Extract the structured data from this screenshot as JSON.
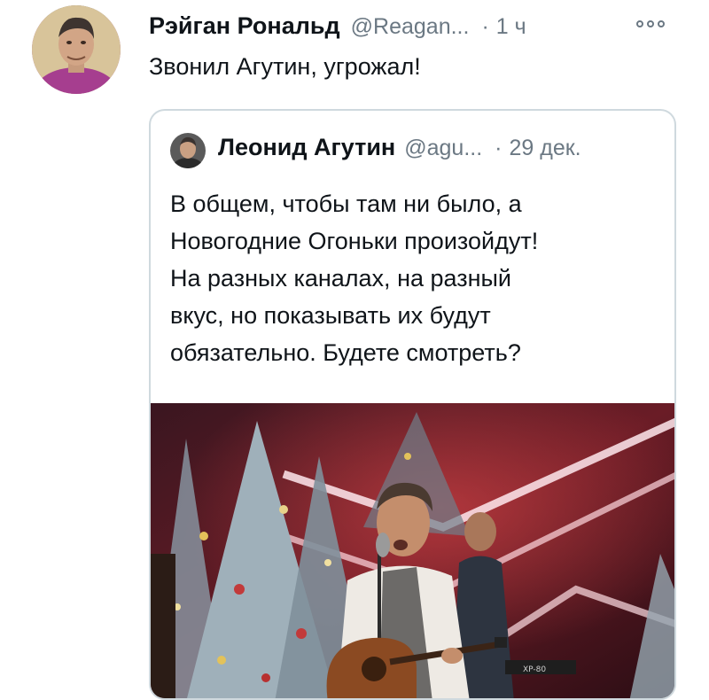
{
  "tweet": {
    "author_name": "Рэйган Рональд",
    "author_handle": "@Reagan...",
    "separator": "·",
    "time": "1 ч",
    "text": "Звонил Агутин, угрожал!"
  },
  "quoted_tweet": {
    "author_name": "Леонид Агутин",
    "author_handle": "@agu...",
    "separator": "·",
    "time": "29 дек.",
    "text_lines": [
      "В общем, чтобы там ни было, а",
      "Новогодние Огоньки произойдут!",
      "На разных каналах, на разный",
      "вкус, но показывать их будут",
      "обязательно. Будете смотреть?"
    ],
    "media_caption": "XP-80"
  },
  "icons": {
    "more": "more-icon"
  },
  "colors": {
    "text_primary": "#0f1419",
    "text_secondary": "#6b7883",
    "border": "#cfd9de"
  }
}
